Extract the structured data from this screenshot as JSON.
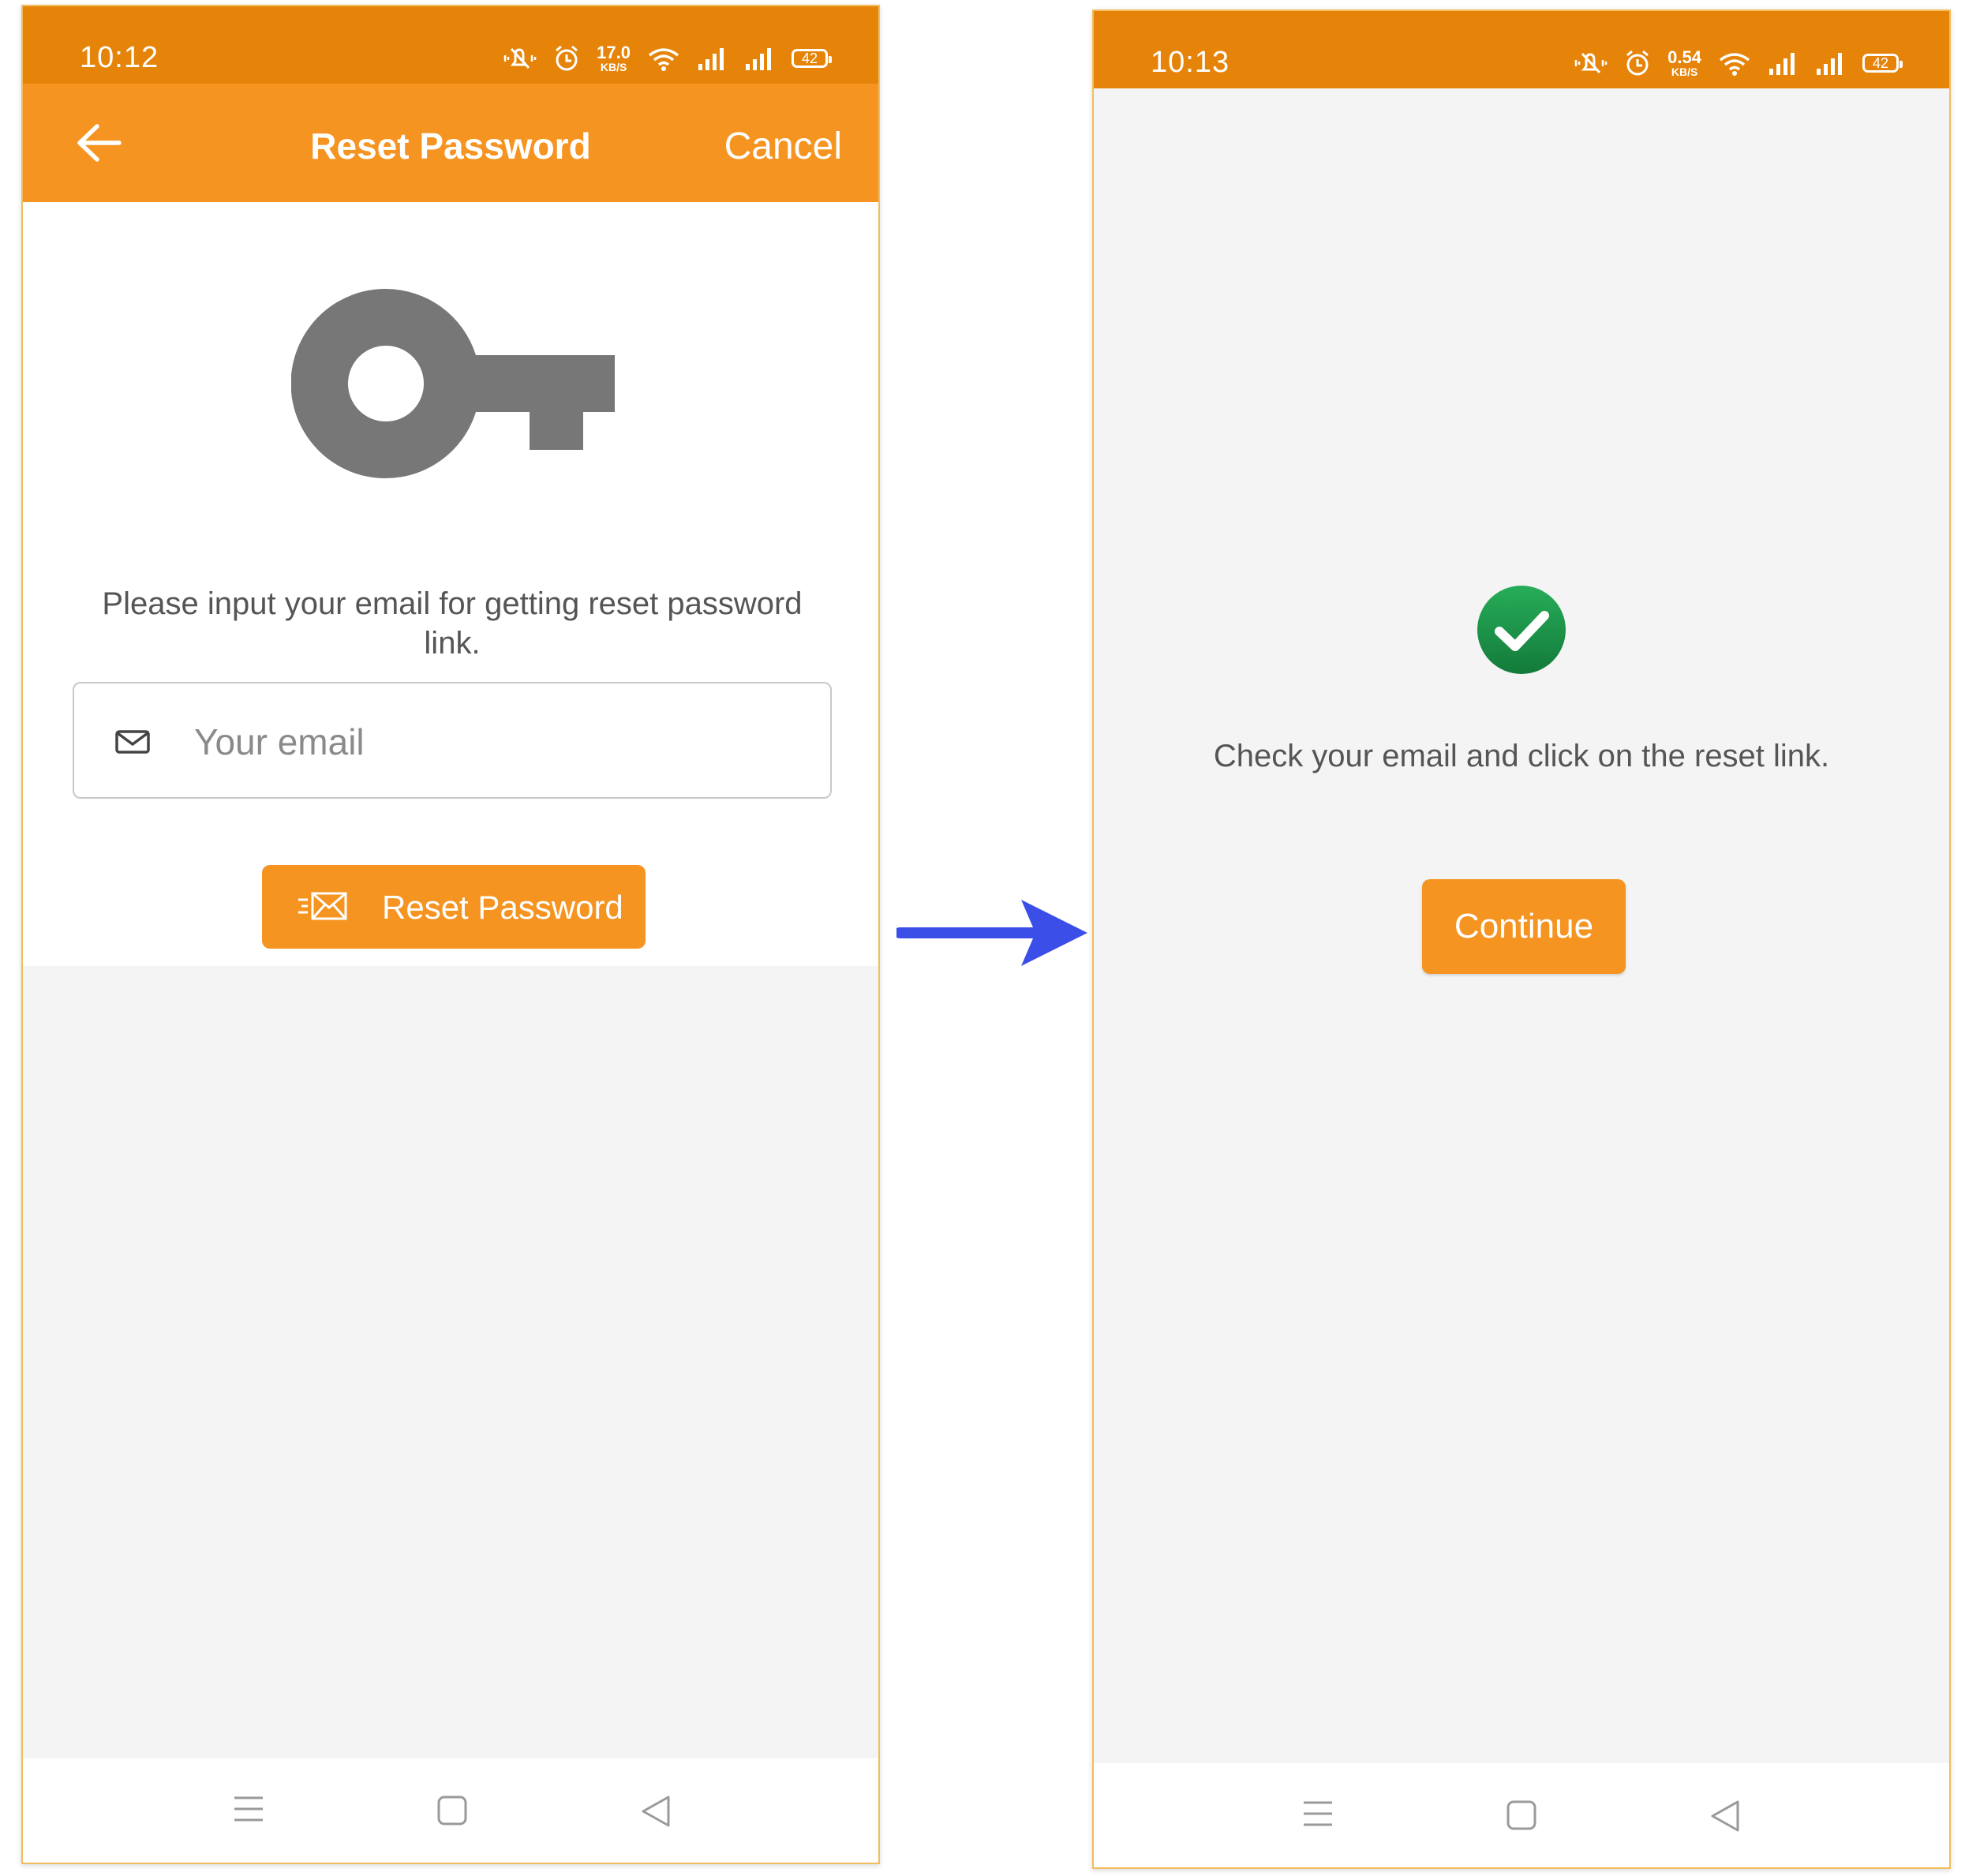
{
  "screens": [
    {
      "status": {
        "time": "10:12",
        "net_speed": "17.0",
        "net_unit": "KB/S",
        "battery": "42"
      },
      "appbar": {
        "title": "Reset Password",
        "cancel": "Cancel"
      },
      "instruction": "Please input your email for getting reset password link.",
      "email": {
        "placeholder": "Your email",
        "value": ""
      },
      "reset_button": "Reset Password"
    },
    {
      "status": {
        "time": "10:13",
        "net_speed": "0.54",
        "net_unit": "KB/S",
        "battery": "42"
      },
      "message": "Check your email and click on the reset link.",
      "continue_button": "Continue"
    }
  ],
  "icons": [
    "back-arrow-icon",
    "key-icon",
    "mail-icon",
    "send-mail-icon",
    "check-circle-icon",
    "flow-arrow-icon"
  ],
  "colors": {
    "status_bar": "#e6840a",
    "app_bar": "#f59421",
    "button": "#f59421",
    "flow_arrow": "#3b4fe8",
    "success": "#1f9a4e"
  }
}
